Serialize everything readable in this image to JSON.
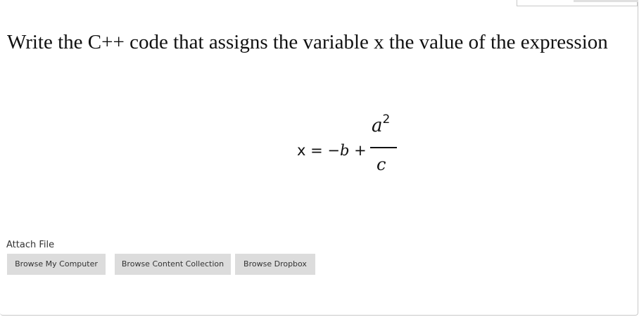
{
  "question": {
    "text": "Write the C++ code that assigns the variable x the value of the expression"
  },
  "equation": {
    "lhs": "x = −",
    "var_b": "b",
    "plus": " +",
    "numerator_var": "a",
    "numerator_exp": "2",
    "denominator": "c"
  },
  "attach": {
    "label": "Attach File",
    "buttons": {
      "computer": "Browse My Computer",
      "collection": "Browse Content Collection",
      "dropbox": "Browse Dropbox"
    }
  }
}
